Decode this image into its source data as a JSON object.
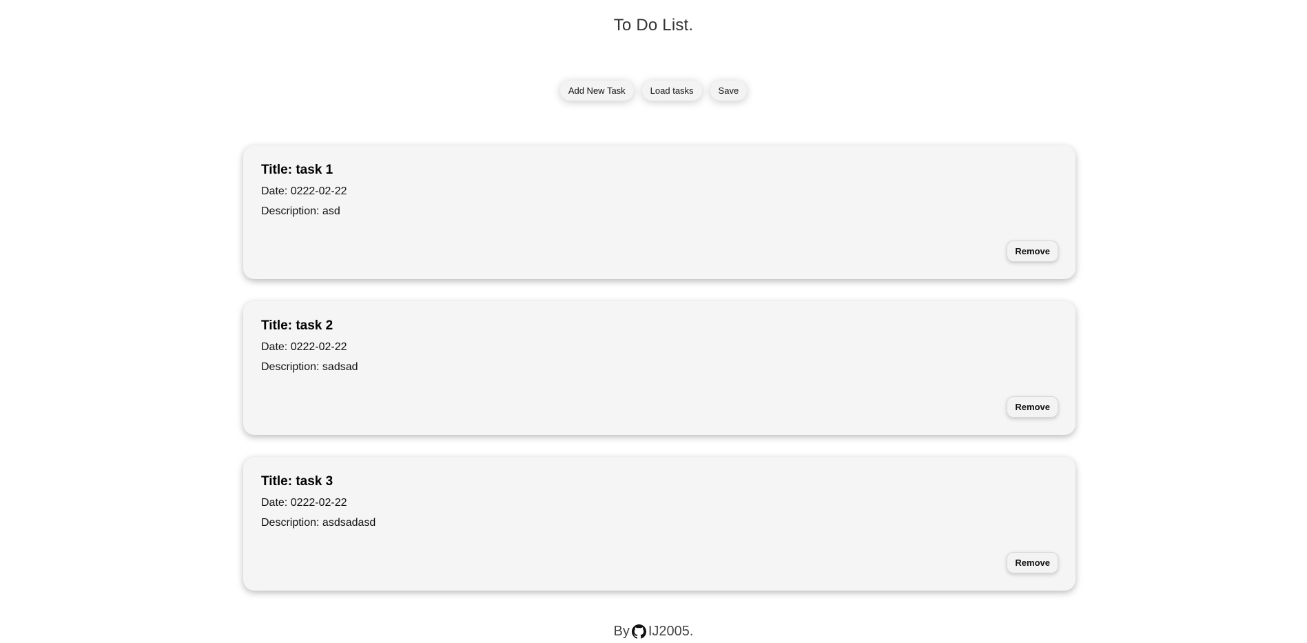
{
  "page": {
    "title": "To Do List."
  },
  "toolbar": {
    "add_label": "Add New Task",
    "load_label": "Load tasks",
    "save_label": "Save"
  },
  "tasks": [
    {
      "title": "Title: task 1",
      "date": "Date: 0222-02-22",
      "description": "Description: asd",
      "remove_label": "Remove"
    },
    {
      "title": "Title: task 2",
      "date": "Date: 0222-02-22",
      "description": "Description: sadsad",
      "remove_label": "Remove"
    },
    {
      "title": "Title: task 3",
      "date": "Date: 0222-02-22",
      "description": "Description: asdsadasd",
      "remove_label": "Remove"
    }
  ],
  "footer": {
    "by_label": "By",
    "icon": "github-icon",
    "author_label": "IJ2005."
  }
}
